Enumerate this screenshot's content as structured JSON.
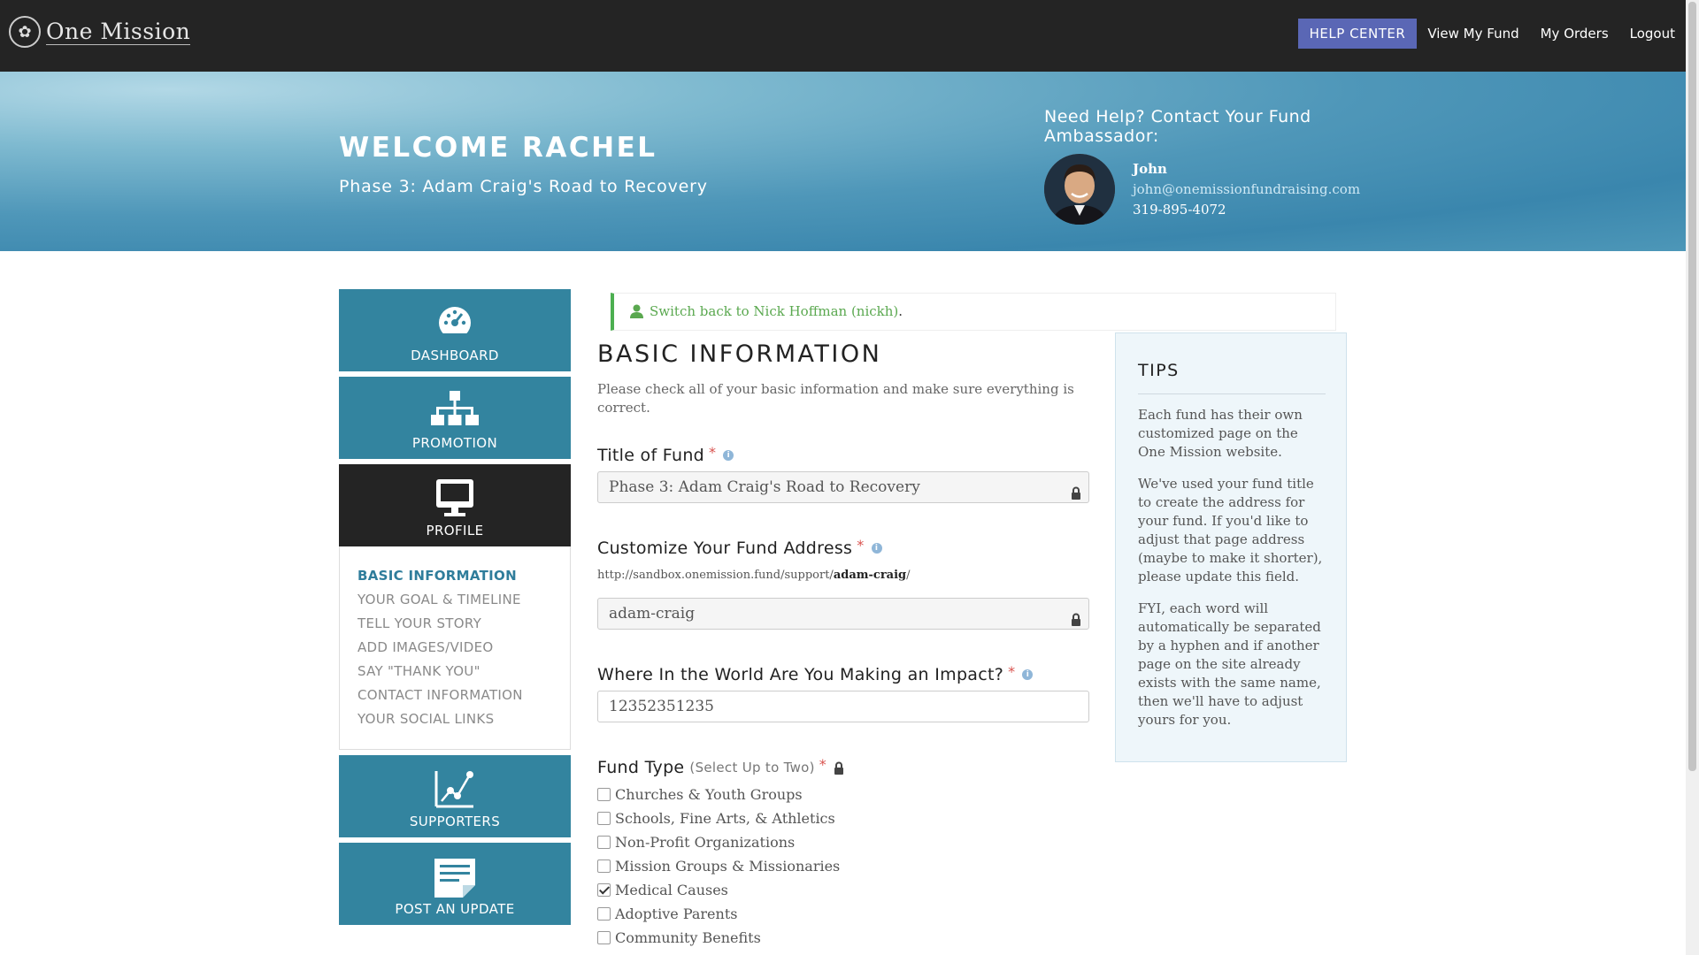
{
  "header": {
    "logo_text": "One Mission",
    "nav": {
      "help_center": "HELP CENTER",
      "view_my_fund": "View My Fund",
      "my_orders": "My Orders",
      "logout": "Logout"
    }
  },
  "hero": {
    "welcome": "WELCOME RACHEL",
    "fund_title": "Phase 3: Adam Craig's Road to Recovery",
    "help_heading": "Need Help? Contact Your Fund Ambassador:",
    "ambassador": {
      "name": "John",
      "email": "john@onemissionfundraising.com",
      "phone": "319-895-4072"
    }
  },
  "sidebar": {
    "tiles": [
      {
        "label": "DASHBOARD",
        "icon": "dashboard-icon"
      },
      {
        "label": "PROMOTION",
        "icon": "org-chart-icon"
      },
      {
        "label": "PROFILE",
        "icon": "monitor-icon"
      },
      {
        "label": "SUPPORTERS",
        "icon": "growth-chart-icon"
      },
      {
        "label": "POST AN UPDATE",
        "icon": "note-icon"
      }
    ],
    "profile_links": [
      "BASIC INFORMATION",
      "YOUR GOAL & TIMELINE",
      "TELL YOUR STORY",
      "ADD IMAGES/VIDEO",
      "SAY \"THANK YOU\"",
      "CONTACT INFORMATION",
      "YOUR SOCIAL LINKS"
    ]
  },
  "notice": {
    "link_text": "Switch back to Nick Hoffman (nickh)",
    "suffix": "."
  },
  "main": {
    "heading": "BASIC INFORMATION",
    "intro": "Please check all of your basic information and make sure everything is correct.",
    "title_label": "Title of Fund",
    "title_value": "Phase 3: Adam Craig's Road to Recovery",
    "address_label": "Customize Your Fund Address",
    "address_prefix": "http://sandbox.onemission.fund/support/",
    "address_slug_shown": "adam-craig",
    "address_suffix": "/",
    "address_value": "adam-craig",
    "impact_label": "Where In the World Are You Making an Impact?",
    "impact_value": "12352351235",
    "fund_type_label": "Fund Type",
    "fund_type_hint": "(Select Up to Two)",
    "fund_types": [
      {
        "label": "Churches & Youth Groups",
        "checked": false
      },
      {
        "label": "Schools, Fine Arts, & Athletics",
        "checked": false
      },
      {
        "label": "Non-Profit Organizations",
        "checked": false
      },
      {
        "label": "Mission Groups & Missionaries",
        "checked": false
      },
      {
        "label": "Medical Causes",
        "checked": true
      },
      {
        "label": "Adoptive Parents",
        "checked": false
      },
      {
        "label": "Community Benefits",
        "checked": false
      }
    ],
    "required_mark": "*",
    "info_glyph": "i"
  },
  "tips": {
    "heading": "TIPS",
    "paragraphs": [
      "Each fund has their own customized page on the One Mission website.",
      "We've used your fund title to create the address for your fund. If you'd like to adjust that page address (maybe to make it shorter), please update this field.",
      "FYI, each word will automatically be separated by a hyphen and if another page on the site already exists with the same name, then we'll have to adjust yours for you."
    ]
  },
  "colors": {
    "topbar": "#242424",
    "help_button": "#5a67b5",
    "tile": "#33849f",
    "tile_active": "#242424",
    "notice_accent": "#4caf50",
    "required": "#d9534f"
  }
}
